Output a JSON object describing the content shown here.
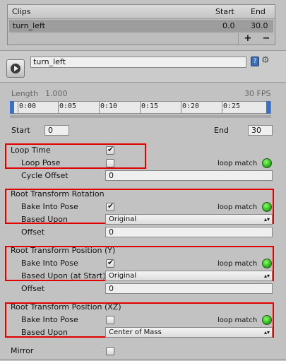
{
  "clips": {
    "header": {
      "name": "Clips",
      "start": "Start",
      "end": "End"
    },
    "rows": [
      {
        "name": "turn_left",
        "start": "0.0",
        "end": "30.0"
      }
    ],
    "add_label": "+",
    "remove_label": "−"
  },
  "clip": {
    "name": "turn_left"
  },
  "timeline": {
    "length_label": "Length",
    "length_value": "1.000",
    "fps": "30 FPS",
    "ticks": [
      "0:00",
      "0:05",
      "0:10",
      "0:15",
      "0:20",
      "0:25"
    ]
  },
  "range": {
    "start_label": "Start",
    "start_value": "0",
    "end_label": "End",
    "end_value": "30"
  },
  "loop": {
    "loop_time_label": "Loop Time",
    "loop_time_checked": true,
    "loop_pose_label": "Loop Pose",
    "loop_pose_checked": false,
    "loop_match": "loop match",
    "cycle_offset_label": "Cycle Offset",
    "cycle_offset_value": "0"
  },
  "rotation": {
    "title": "Root Transform Rotation",
    "bake_label": "Bake Into Pose",
    "bake_checked": true,
    "loop_match": "loop match",
    "based_upon_label": "Based Upon",
    "based_upon_value": "Original",
    "offset_label": "Offset",
    "offset_value": "0"
  },
  "position_y": {
    "title": "Root Transform Position (Y)",
    "bake_label": "Bake Into Pose",
    "bake_checked": true,
    "loop_match": "loop match",
    "based_upon_label": "Based Upon (at Start)",
    "based_upon_value": "Original",
    "offset_label": "Offset",
    "offset_value": "0"
  },
  "position_xz": {
    "title": "Root Transform Position (XZ)",
    "bake_label": "Bake Into Pose",
    "bake_checked": false,
    "loop_match": "loop match",
    "based_upon_label": "Based Upon",
    "based_upon_value": "Center of Mass"
  },
  "mirror": {
    "label": "Mirror",
    "checked": false
  },
  "colors": {
    "highlight_box": "#e00000",
    "loop_match_ok": "#2bb51c",
    "timeline_marker": "#3b6fc6"
  }
}
